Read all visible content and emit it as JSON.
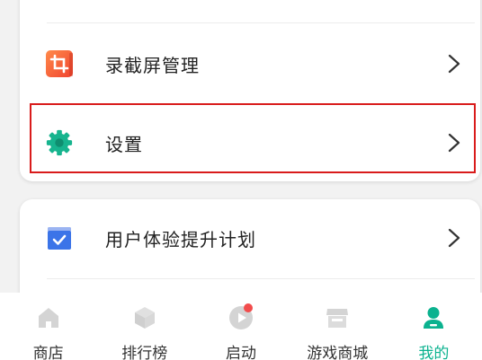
{
  "menu_top": {
    "items": [
      {
        "label": "录截屏管理",
        "icon": "screenshot-crop-icon"
      },
      {
        "label": "设置",
        "icon": "gear-icon"
      }
    ]
  },
  "menu_bottom": {
    "items": [
      {
        "label": "用户体验提升计划",
        "icon": "checklist-icon"
      }
    ]
  },
  "tabbar": {
    "tabs": [
      {
        "label": "商店",
        "icon": "home-icon",
        "active": false
      },
      {
        "label": "排行榜",
        "icon": "cube-icon",
        "active": false
      },
      {
        "label": "启动",
        "icon": "play-icon",
        "active": false,
        "badge": true
      },
      {
        "label": "游戏商城",
        "icon": "store-icon",
        "active": false
      },
      {
        "label": "我的",
        "icon": "user-icon",
        "active": true
      }
    ]
  },
  "colors": {
    "accent": "#0bb28f",
    "highlight_border": "#d91b1b",
    "badge": "#f24c4c"
  }
}
